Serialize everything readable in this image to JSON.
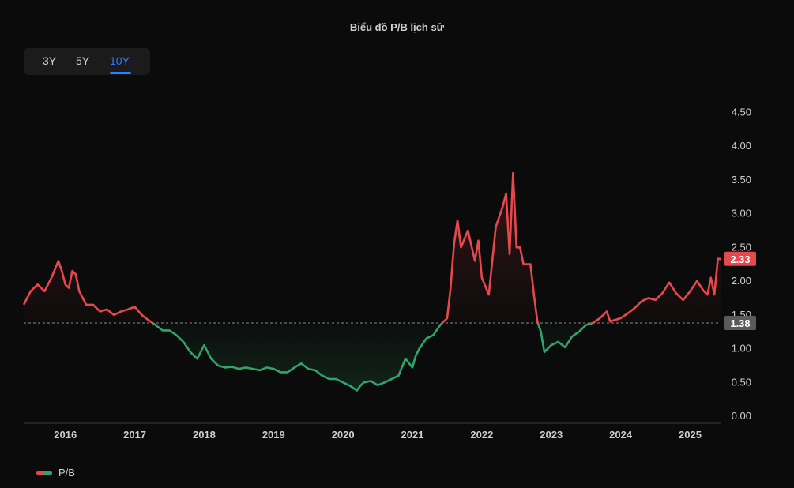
{
  "chart_title": "Biểu đồ P/B lịch sử",
  "range_tabs": [
    {
      "label": "3Y",
      "active": false
    },
    {
      "label": "5Y",
      "active": false
    },
    {
      "label": "10Y",
      "active": true
    }
  ],
  "legend": {
    "label": "P/B"
  },
  "colors": {
    "above": "#e5484d",
    "below": "#30a46c",
    "accent": "#2f7dff",
    "background": "#0b0b0b"
  },
  "chart_data": {
    "type": "line",
    "title": "Biểu đồ P/B lịch sử",
    "series_name": "P/B",
    "y_axis_position": "right",
    "ylim": [
      0,
      4.5
    ],
    "y_ticks": [
      "0.00",
      "0.50",
      "1.00",
      "1.50",
      "2.00",
      "2.50",
      "3.00",
      "3.50",
      "4.00",
      "4.50"
    ],
    "x_ticks": [
      "2016",
      "2017",
      "2018",
      "2019",
      "2020",
      "2021",
      "2022",
      "2023",
      "2024",
      "2025"
    ],
    "xlim": [
      2015.4,
      2025.45
    ],
    "reference_line": {
      "value": 1.38,
      "label": "1.38",
      "style": "dashed"
    },
    "last_value": {
      "value": 2.33,
      "label": "2.33"
    },
    "grid": false,
    "coloring": "red above reference line, green below",
    "x": [
      2015.4,
      2015.5,
      2015.6,
      2015.7,
      2015.8,
      2015.9,
      2015.95,
      2016.0,
      2016.05,
      2016.1,
      2016.15,
      2016.2,
      2016.3,
      2016.4,
      2016.5,
      2016.6,
      2016.7,
      2016.8,
      2016.9,
      2017.0,
      2017.1,
      2017.2,
      2017.3,
      2017.4,
      2017.5,
      2017.6,
      2017.7,
      2017.8,
      2017.9,
      2018.0,
      2018.1,
      2018.2,
      2018.3,
      2018.4,
      2018.5,
      2018.6,
      2018.7,
      2018.8,
      2018.9,
      2019.0,
      2019.1,
      2019.2,
      2019.3,
      2019.4,
      2019.5,
      2019.6,
      2019.7,
      2019.8,
      2019.9,
      2020.0,
      2020.1,
      2020.2,
      2020.25,
      2020.3,
      2020.4,
      2020.5,
      2020.6,
      2020.7,
      2020.8,
      2020.9,
      2021.0,
      2021.05,
      2021.1,
      2021.2,
      2021.3,
      2021.4,
      2021.5,
      2021.55,
      2021.6,
      2021.65,
      2021.7,
      2021.8,
      2021.9,
      2021.95,
      2022.0,
      2022.1,
      2022.2,
      2022.3,
      2022.35,
      2022.4,
      2022.45,
      2022.5,
      2022.55,
      2022.6,
      2022.7,
      2022.75,
      2022.8,
      2022.85,
      2022.9,
      2023.0,
      2023.1,
      2023.2,
      2023.3,
      2023.4,
      2023.5,
      2023.6,
      2023.7,
      2023.8,
      2023.85,
      2023.9,
      2024.0,
      2024.1,
      2024.2,
      2024.3,
      2024.4,
      2024.5,
      2024.6,
      2024.7,
      2024.8,
      2024.9,
      2025.0,
      2025.1,
      2025.2,
      2025.25,
      2025.3,
      2025.35,
      2025.4,
      2025.45
    ],
    "y": [
      1.65,
      1.85,
      1.95,
      1.85,
      2.05,
      2.3,
      2.15,
      1.95,
      1.9,
      2.15,
      2.1,
      1.85,
      1.65,
      1.65,
      1.55,
      1.58,
      1.5,
      1.55,
      1.58,
      1.62,
      1.5,
      1.42,
      1.35,
      1.27,
      1.27,
      1.2,
      1.1,
      0.95,
      0.85,
      1.05,
      0.85,
      0.75,
      0.72,
      0.73,
      0.7,
      0.72,
      0.7,
      0.68,
      0.72,
      0.7,
      0.65,
      0.65,
      0.72,
      0.78,
      0.7,
      0.68,
      0.6,
      0.55,
      0.55,
      0.5,
      0.45,
      0.38,
      0.45,
      0.5,
      0.52,
      0.46,
      0.5,
      0.55,
      0.6,
      0.85,
      0.72,
      0.9,
      1.0,
      1.15,
      1.2,
      1.35,
      1.45,
      1.9,
      2.55,
      2.9,
      2.5,
      2.75,
      2.3,
      2.6,
      2.05,
      1.8,
      2.8,
      3.1,
      3.3,
      2.4,
      3.6,
      2.5,
      2.5,
      2.25,
      2.25,
      1.8,
      1.4,
      1.25,
      0.95,
      1.05,
      1.1,
      1.02,
      1.18,
      1.25,
      1.35,
      1.38,
      1.45,
      1.55,
      1.4,
      1.42,
      1.45,
      1.52,
      1.6,
      1.7,
      1.75,
      1.72,
      1.82,
      1.98,
      1.82,
      1.72,
      1.85,
      2.0,
      1.85,
      1.8,
      2.05,
      1.8,
      2.33,
      2.33
    ]
  }
}
